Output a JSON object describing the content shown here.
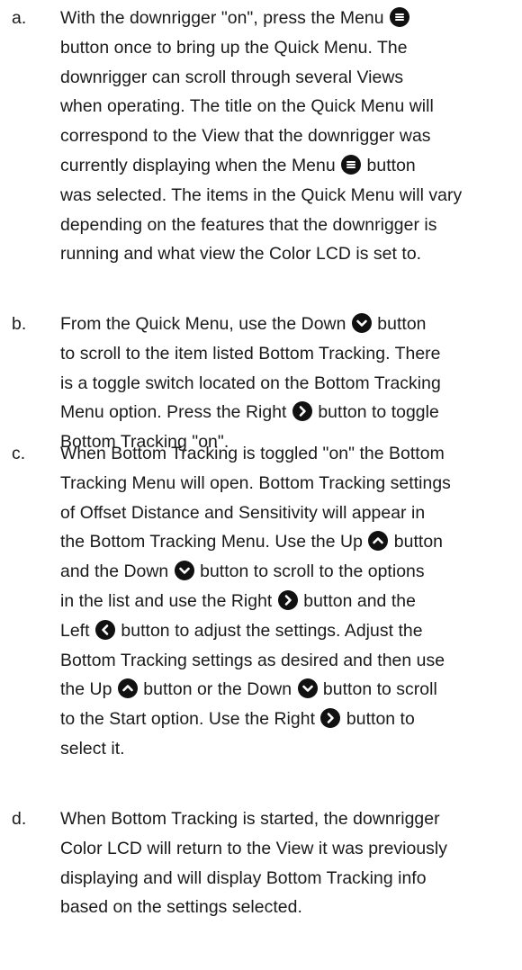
{
  "steps": [
    {
      "marker": "a.",
      "lines": [
        [
          "With the downrigger \"on\", press the Menu ",
          {
            "icon": "menu"
          }
        ],
        [
          "button once to bring up the Quick Menu. The"
        ],
        [
          "downrigger can scroll through several Views"
        ],
        [
          "when operating. The title on the Quick Menu will"
        ],
        [
          "correspond to the View that the downrigger was"
        ],
        [
          "currently displaying when the Menu ",
          {
            "icon": "menu"
          },
          " button"
        ],
        [
          "was selected. The items in the Quick Menu will vary"
        ],
        [
          "depending on the features that the downrigger is"
        ],
        [
          "running and what view the Color LCD is set to."
        ]
      ]
    },
    {
      "marker": "b.",
      "lines": [
        [
          "From the Quick Menu, use the Down ",
          {
            "icon": "down"
          },
          " button"
        ],
        [
          "to scroll to the item listed Bottom Tracking. There"
        ],
        [
          "is a toggle switch located on the Bottom Tracking"
        ],
        [
          "Menu option. Press the Right ",
          {
            "icon": "right"
          },
          " button to toggle"
        ],
        [
          "Bottom Tracking \"on\"."
        ]
      ]
    },
    {
      "marker": "c.",
      "lines": [
        [
          "When Bottom Tracking is toggled \"on\" the Bottom"
        ],
        [
          "Tracking Menu will open. Bottom Tracking settings"
        ],
        [
          "of Offset Distance and Sensitivity will appear in"
        ],
        [
          "the Bottom Tracking Menu. Use the Up ",
          {
            "icon": "up"
          },
          " button"
        ],
        [
          "and the Down ",
          {
            "icon": "down"
          },
          " button to scroll to the options"
        ],
        [
          "in the list and use the Right ",
          {
            "icon": "right"
          },
          " button and the"
        ],
        [
          "Left ",
          {
            "icon": "left"
          },
          " button to adjust the settings. Adjust the"
        ],
        [
          "Bottom Tracking settings as desired and then use"
        ],
        [
          "the Up ",
          {
            "icon": "up"
          },
          " button or the Down ",
          {
            "icon": "down"
          },
          " button to scroll"
        ],
        [
          "to the Start option. Use the Right ",
          {
            "icon": "right"
          },
          " button to"
        ],
        [
          "select it."
        ]
      ]
    },
    {
      "marker": "d.",
      "lines": [
        [
          "When Bottom Tracking is started, the downrigger"
        ],
        [
          "Color LCD will return to the View it was previously"
        ],
        [
          "displaying and will display Bottom Tracking info"
        ],
        [
          "based on the settings selected."
        ]
      ]
    }
  ],
  "icons": {
    "menu": "menu-button-icon",
    "down": "down-button-icon",
    "up": "up-button-icon",
    "right": "right-button-icon",
    "left": "left-button-icon"
  },
  "colors": {
    "text": "#1a1a1a",
    "icon_fill": "#111111",
    "icon_glyph": "#ffffff"
  }
}
